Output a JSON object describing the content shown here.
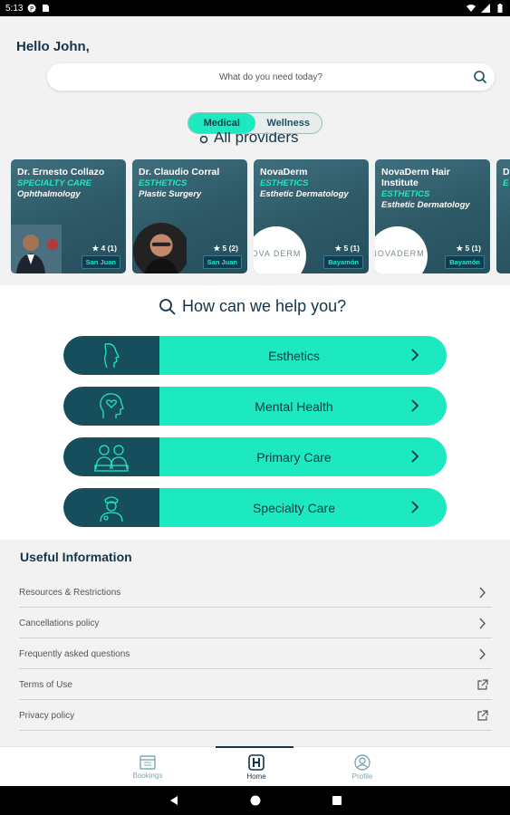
{
  "status_bar": {
    "time": "5:13"
  },
  "greeting": "Hello John,",
  "search": {
    "placeholder": "What do you need today?"
  },
  "toggle": {
    "options": [
      "Medical",
      "Wellness"
    ],
    "active": "Medical"
  },
  "providers": {
    "title": "All providers",
    "cards": [
      {
        "name": "Dr. Ernesto Collazo",
        "category": "SPECIALTY CARE",
        "specialty": "Ophthalmology",
        "rating": "4 (1)",
        "location": "San Juan"
      },
      {
        "name": "Dr. Claudio Corral",
        "category": "ESTHETICS",
        "specialty": "Plastic Surgery",
        "rating": "5 (2)",
        "location": "San Juan"
      },
      {
        "name": "NovaDerm",
        "category": "ESTHETICS",
        "specialty": "Esthetic Dermatology",
        "rating": "5 (1)",
        "location": "Bayamón",
        "logo_text": "OVA DERM"
      },
      {
        "name": "NovaDerm Hair Institute",
        "category": "ESTHETICS",
        "specialty": "Esthetic Dermatology",
        "rating": "5 (1)",
        "location": "Bayamón",
        "logo_text": "NOVADERM"
      },
      {
        "name": "D",
        "category": "E",
        "specialty": "",
        "rating": "",
        "location": ""
      }
    ]
  },
  "help": {
    "title": "How can we help you?",
    "services": [
      {
        "label": "Esthetics",
        "icon": "face-profile-icon"
      },
      {
        "label": "Mental Health",
        "icon": "head-heart-icon"
      },
      {
        "label": "Primary Care",
        "icon": "doctors-icon"
      },
      {
        "label": "Specialty Care",
        "icon": "nurse-icon"
      }
    ]
  },
  "useful": {
    "title": "Useful Information",
    "items": [
      {
        "label": "Resources & Restrictions",
        "icon": "chevron-right-icon"
      },
      {
        "label": "Cancellations policy",
        "icon": "chevron-right-icon"
      },
      {
        "label": "Frequently asked questions",
        "icon": "chevron-right-icon"
      },
      {
        "label": "Terms of Use",
        "icon": "external-link-icon"
      },
      {
        "label": "Privacy policy",
        "icon": "external-link-icon"
      }
    ]
  },
  "tabs": [
    {
      "label": "Bookings",
      "icon": "calendar-icon"
    },
    {
      "label": "Home",
      "icon": "hospital-icon"
    },
    {
      "label": "Profile",
      "icon": "profile-icon"
    }
  ],
  "colors": {
    "accent": "#1de9c0",
    "dark_teal": "#174e5d",
    "navy": "#13344a"
  }
}
